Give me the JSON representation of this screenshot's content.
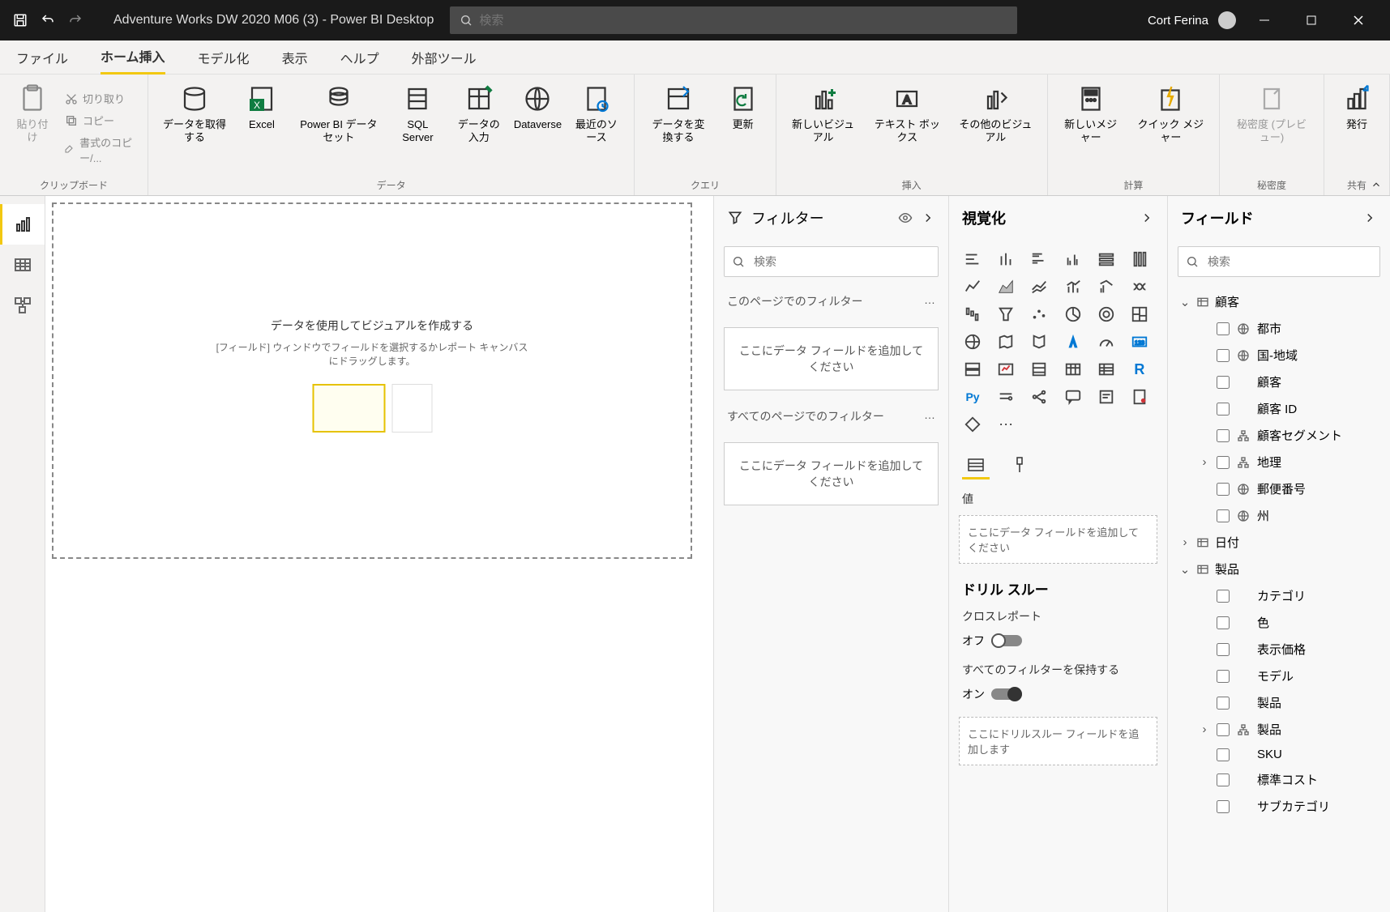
{
  "titlebar": {
    "title": "Adventure Works DW 2020 M06 (3) - Power BI Desktop",
    "search_placeholder": "検索",
    "user": "Cort Ferina"
  },
  "tabs": {
    "file": "ファイル",
    "home": "ホーム挿入",
    "modeling": "モデル化",
    "view": "表示",
    "help": "ヘルプ",
    "external": "外部ツール"
  },
  "ribbon": {
    "clipboard": {
      "paste": "貼り付け",
      "cut": "切り取り",
      "copy": "コピー",
      "format_painter": "書式のコピー/...",
      "group": "クリップボード"
    },
    "data": {
      "get_data": "データを取得する",
      "excel": "Excel",
      "pbi_dataset": "Power BI データセット",
      "sql_server": "SQL Server",
      "enter_data": "データの入力",
      "dataverse": "Dataverse",
      "recent": "最近のソース",
      "group": "データ"
    },
    "queries": {
      "transform": "データを変換する",
      "refresh": "更新",
      "group": "クエリ"
    },
    "insert": {
      "new_visual": "新しいビジュアル",
      "text_box": "テキスト ボックス",
      "more_visuals": "その他のビジュアル",
      "group": "挿入"
    },
    "calc": {
      "new_measure": "新しいメジャー",
      "quick_measure": "クイック メジャー",
      "group": "計算"
    },
    "sensitivity": {
      "label": "秘密度 (プレビュー)",
      "group": "秘密度"
    },
    "share": {
      "publish": "発行",
      "group": "共有"
    }
  },
  "canvas": {
    "title": "データを使用してビジュアルを作成する",
    "subtitle": "[フィールド] ウィンドウでフィールドを選択するかレポート キャンバスにドラッグします。"
  },
  "filters": {
    "title": "フィルター",
    "search_placeholder": "検索",
    "page_filters": "このページでのフィルター",
    "all_pages_filters": "すべてのページでのフィルター",
    "dropzone": "ここにデータ フィールドを追加してください"
  },
  "viz": {
    "title": "視覚化",
    "values": "値",
    "values_dropzone": "ここにデータ フィールドを追加してください",
    "drill": {
      "title": "ドリル スルー",
      "cross_report": "クロスレポート",
      "off": "オフ",
      "keep_filters": "すべてのフィルターを保持する",
      "on": "オン",
      "dropzone": "ここにドリルスルー フィールドを追加します"
    }
  },
  "fields": {
    "title": "フィールド",
    "search_placeholder": "検索",
    "tables": [
      {
        "name": "顧客",
        "expanded": true,
        "fields": [
          {
            "name": "都市",
            "icon": "globe"
          },
          {
            "name": "国-地域",
            "icon": "globe"
          },
          {
            "name": "顧客",
            "icon": ""
          },
          {
            "name": "顧客 ID",
            "icon": ""
          },
          {
            "name": "顧客セグメント",
            "icon": "hierarchy"
          },
          {
            "name": "地理",
            "icon": "hierarchy",
            "expandable": true
          },
          {
            "name": "郵便番号",
            "icon": "globe"
          },
          {
            "name": "州",
            "icon": "globe"
          }
        ]
      },
      {
        "name": "日付",
        "expanded": false
      },
      {
        "name": "製品",
        "expanded": true,
        "fields": [
          {
            "name": "カテゴリ",
            "icon": ""
          },
          {
            "name": "色",
            "icon": ""
          },
          {
            "name": "表示価格",
            "icon": ""
          },
          {
            "name": "モデル",
            "icon": ""
          },
          {
            "name": "製品",
            "icon": ""
          },
          {
            "name": "製品",
            "icon": "hierarchy",
            "expandable": true
          },
          {
            "name": "SKU",
            "icon": ""
          },
          {
            "name": "標準コスト",
            "icon": ""
          },
          {
            "name": "サブカテゴリ",
            "icon": ""
          }
        ]
      }
    ]
  }
}
